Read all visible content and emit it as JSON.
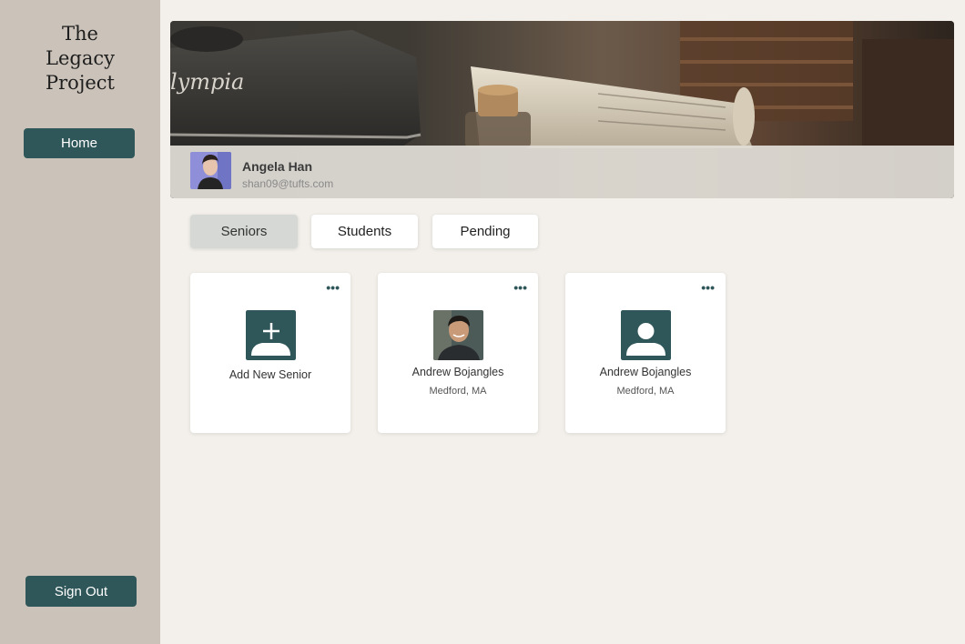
{
  "app": {
    "title_line1": "The Legacy",
    "title_line2": "Project"
  },
  "sidebar": {
    "home_label": "Home",
    "signout_label": "Sign Out"
  },
  "banner": {
    "typewriter_brand": "lympia"
  },
  "profile": {
    "name": "Angela Han",
    "email": "shan09@tufts.com"
  },
  "tabs": [
    {
      "label": "Seniors",
      "active": true
    },
    {
      "label": "Students",
      "active": false
    },
    {
      "label": "Pending",
      "active": false
    }
  ],
  "cards": [
    {
      "title": "Add New Senior",
      "subtitle": "",
      "icon": "add-person-icon",
      "menu": "•••"
    },
    {
      "title": "Andrew Bojangles",
      "subtitle": "Medford, MA",
      "icon": "person-photo",
      "menu": "•••"
    },
    {
      "title": "Andrew Bojangles",
      "subtitle": "Medford, MA",
      "icon": "person-placeholder-icon",
      "menu": "•••"
    }
  ],
  "colors": {
    "accent": "#2f5659",
    "sidebar": "#cbc3b9",
    "background": "#f3f0eb"
  }
}
